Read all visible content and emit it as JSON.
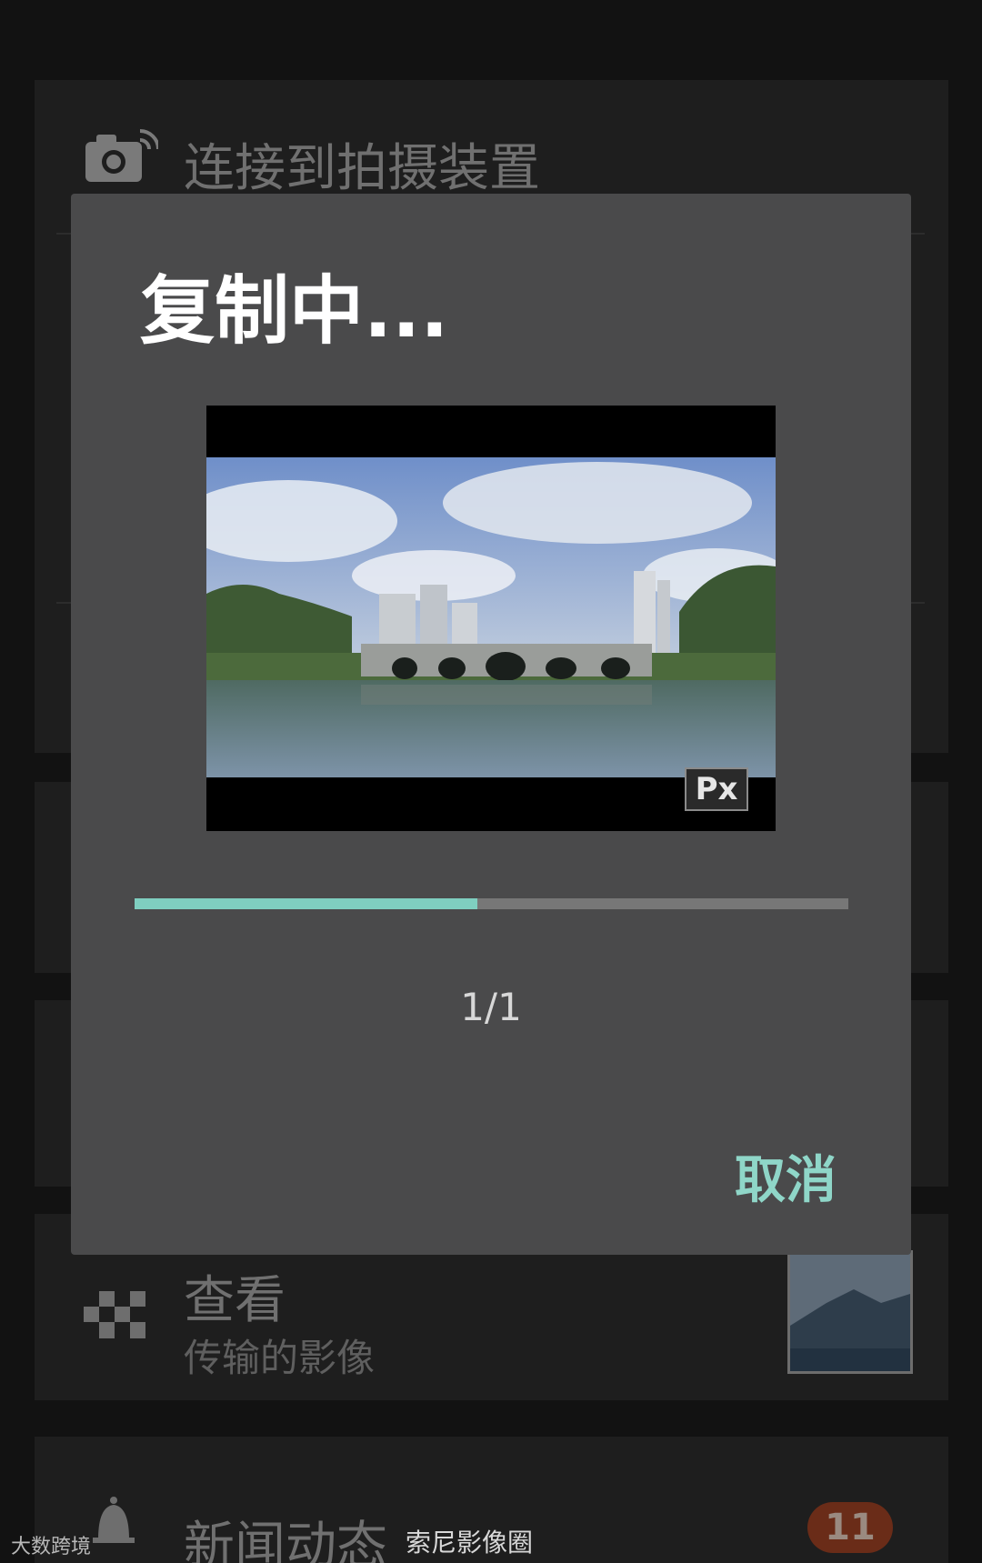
{
  "background": {
    "connect_label": "连接到拍摄装置",
    "view_title": "查看",
    "view_subtitle": "传输的影像",
    "news_label": "新闻动态",
    "news_count": "11"
  },
  "dialog": {
    "title": "复制中...",
    "progress": 0.48,
    "counter": "1/1",
    "cancel_label": "取消",
    "preview_badge": "Px"
  },
  "watermarks": {
    "left": "大数跨境",
    "right": "索尼影像圈"
  },
  "colors": {
    "accent": "#7fcfc0",
    "dialog_bg": "#4a4a4b",
    "screen_bg": "#121212"
  }
}
